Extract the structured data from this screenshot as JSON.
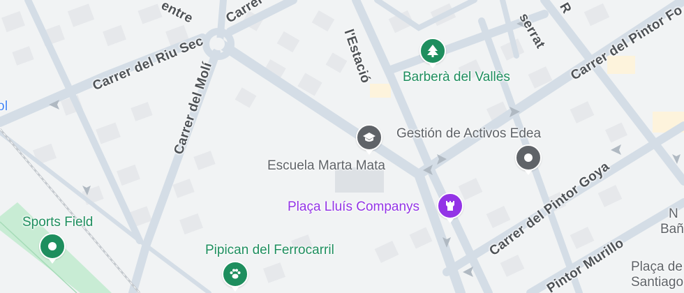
{
  "map": {
    "streets": {
      "centre": "entre",
      "carrer_top": "Carrer",
      "estacio": "l'Estació",
      "serrat": "serrat",
      "r_top": "R",
      "riu_sec": "Carrer del Riu Sec",
      "moli": "Carrer del Molí",
      "pintor_fortuny": "Carrer del Pintor Fo",
      "pintor_goya": "Carrer del Pintor Goya",
      "pintor_murillo": "Pintor Murillo",
      "edge_left": "ol"
    },
    "pois": {
      "barbera": "Barberà del Vallès",
      "gestion": "Gestión de Activos Edea",
      "escuela": "Escuela Marta Mata",
      "placa_lluis": "Plaça Lluís Companys",
      "sports_field": "Sports Field",
      "pipican": "Pipican del Ferrocarril",
      "nobanes_a": "N",
      "nobanes_b": "Bañ",
      "placa_santiago_a": "Plaça de",
      "placa_santiago_b": "Santiago"
    },
    "colors": {
      "background": "#f1f3f4",
      "road": "#d4dde6",
      "building": "#e6e8eb",
      "park": "#c8ecd4",
      "green_poi": "#1e8e5e",
      "grey_poi": "#5f6368",
      "purple_poi": "#9334e6"
    },
    "icons": {
      "barbera": "tree-icon",
      "gestion": "pin-dot-icon",
      "escuela": "graduation-cap-icon",
      "placa_lluis": "castle-icon",
      "sports_field": "pin-dot-icon",
      "pipican": "paw-icon"
    }
  }
}
